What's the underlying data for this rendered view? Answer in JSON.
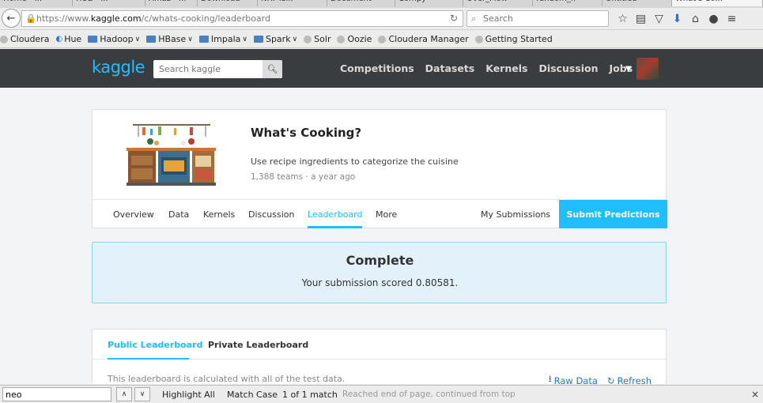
{
  "browser": {
    "tabs": [
      "Home - ...",
      "HUE - ...",
      "Amaz - ...",
      "Download",
      "N.Y. Talk",
      "Document",
      "Compy",
      "Over_Flow",
      "random_fl",
      "Untitled",
      "What's Co..."
    ],
    "url_prefix": "https://www.",
    "url_domain": "kaggle.com",
    "url_path": "/c/whats-cooking/leaderboard",
    "search_placeholder": "Search",
    "bookmarks": [
      {
        "label": "Cloudera",
        "kind": "globe"
      },
      {
        "label": "Hue",
        "kind": "hue"
      },
      {
        "label": "Hadoop",
        "kind": "folder",
        "dropdown": true
      },
      {
        "label": "HBase",
        "kind": "folder",
        "dropdown": true
      },
      {
        "label": "Impala",
        "kind": "folder",
        "dropdown": true
      },
      {
        "label": "Spark",
        "kind": "folder",
        "dropdown": true
      },
      {
        "label": "Solr",
        "kind": "globe"
      },
      {
        "label": "Oozie",
        "kind": "globe"
      },
      {
        "label": "Cloudera Manager",
        "kind": "globe"
      },
      {
        "label": "Getting Started",
        "kind": "globe"
      }
    ]
  },
  "kaggle": {
    "logo": "kaggle",
    "search_placeholder": "Search kaggle",
    "nav": [
      "Competitions",
      "Datasets",
      "Kernels",
      "Discussion",
      "Jobs"
    ],
    "accent": "#20beff"
  },
  "competition": {
    "title": "What's Cooking?",
    "description": "Use recipe ingredients to categorize the cuisine",
    "meta": "1,388 teams · a year ago",
    "tabs": [
      "Overview",
      "Data",
      "Kernels",
      "Discussion",
      "Leaderboard",
      "More"
    ],
    "active_tab": "Leaderboard",
    "my_submissions": "My Submissions",
    "submit": "Submit Predictions"
  },
  "complete": {
    "title": "Complete",
    "score_text": "Your submission scored 0.80581."
  },
  "leaderboard": {
    "tabs": [
      "Public Leaderboard",
      "Private Leaderboard"
    ],
    "note": "This leaderboard is calculated with all of the test data.",
    "raw_data": "Raw Data",
    "refresh": "Refresh"
  },
  "findbar": {
    "query": "neo",
    "highlight_all": "Highlight All",
    "match_case": "Match Case",
    "matches": "1 of 1 match",
    "status": "Reached end of page, continued from top"
  }
}
